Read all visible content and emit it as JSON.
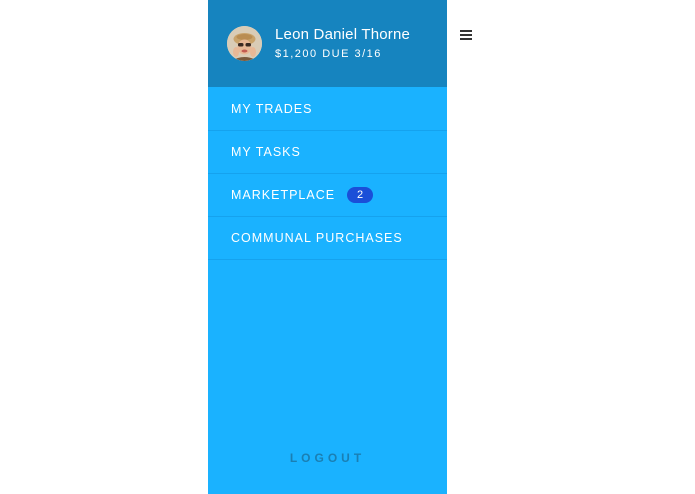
{
  "user": {
    "name": "Leon Daniel Thorne",
    "due": "$1,200 DUE 3/16"
  },
  "menu": {
    "items": [
      {
        "label": "MY TRADES"
      },
      {
        "label": "MY TASKS"
      },
      {
        "label": "MARKETPLACE",
        "badge": "2"
      },
      {
        "label": "COMMUNAL PURCHASES"
      }
    ],
    "logout": "LOGOUT"
  },
  "icons": {
    "menu_toggle": "hamburger-menu-icon",
    "avatar": "user-avatar"
  },
  "colors": {
    "drawer_bg": "#1ab2ff",
    "header_bg": "#1684bf",
    "badge_bg": "#1a4fd8",
    "logout_text": "#1a7fb3"
  }
}
